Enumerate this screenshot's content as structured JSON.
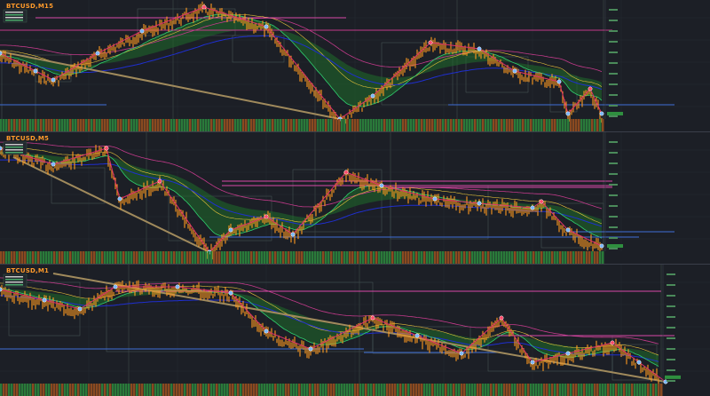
{
  "colors": {
    "background": "#1c1f26",
    "price": "#ff9a1f",
    "zigzag": "#e0306a",
    "trendline": "#a08a5c",
    "ema_fast": "#2fcf6f",
    "ema_slow": "#1f2fd0",
    "channel": "#c23a8a",
    "envelope": "#e6c23a",
    "level": "#d84aa8",
    "support": "#3f6fd8",
    "bull_cloud": "#1f6b2a",
    "bear_cloud": "#5a1a2a",
    "strip_up": "#2a7a3a",
    "strip_down": "#8a4a20"
  },
  "panes": [
    {
      "name": "pane-m15",
      "title": "BTCUSD,M15",
      "indicators": [
        "zigzag",
        "ema",
        "envelope",
        "trendline",
        "levels"
      ]
    },
    {
      "name": "pane-m5",
      "title": "BTCUSD,M5",
      "indicators": [
        "zigzag",
        "ema",
        "envelope",
        "trendline",
        "levels"
      ]
    },
    {
      "name": "pane-m1",
      "title": "BTCUSD,M1",
      "indicators": [
        "zigzag",
        "ema",
        "envelope",
        "trendline",
        "levels"
      ]
    }
  ]
}
